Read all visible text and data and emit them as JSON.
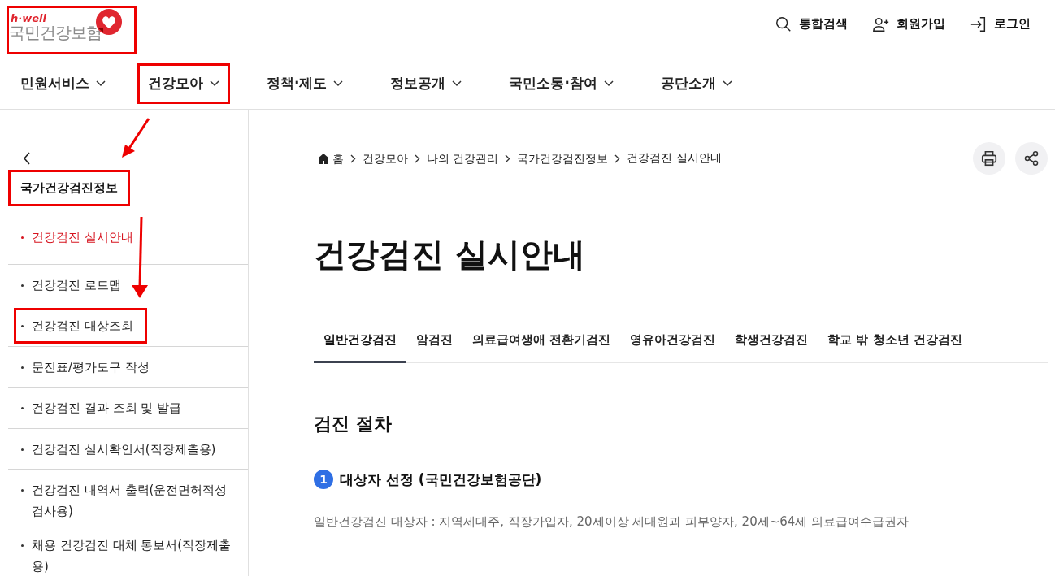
{
  "logo": {
    "tagline": "h·well",
    "name": "국민건강보험",
    "highlighted": true
  },
  "utility_links": [
    {
      "kind": "search",
      "label": "통합검색"
    },
    {
      "kind": "signup",
      "label": "회원가입"
    },
    {
      "kind": "login",
      "label": "로그인"
    }
  ],
  "nav": [
    {
      "label": "민원서비스",
      "highlighted": false
    },
    {
      "label": "건강모아",
      "highlighted": true
    },
    {
      "label": "정책·제도",
      "highlighted": false
    },
    {
      "label": "정보공개",
      "highlighted": false
    },
    {
      "label": "국민소통·참여",
      "highlighted": false
    },
    {
      "label": "공단소개",
      "highlighted": false
    }
  ],
  "sidebar": {
    "title": "국가건강검진정보",
    "title_highlighted": true,
    "items": [
      {
        "label": "건강검진 실시안내",
        "selected": true,
        "highlighted": false
      },
      {
        "label": "건강검진 로드맵",
        "selected": false,
        "highlighted": false
      },
      {
        "label": "건강검진 대상조회",
        "selected": false,
        "highlighted": true
      },
      {
        "label": "문진표/평가도구 작성",
        "selected": false,
        "highlighted": false
      },
      {
        "label": "건강검진 결과 조회 및 발급",
        "selected": false,
        "highlighted": false
      },
      {
        "label": "건강검진 실시확인서(직장제출용)",
        "selected": false,
        "highlighted": false
      },
      {
        "label": "건강검진 내역서 출력(운전면허적성검사용)",
        "selected": false,
        "highlighted": false
      },
      {
        "label": "채용 건강검진 대체 통보서(직장제출용)",
        "selected": false,
        "highlighted": false
      }
    ]
  },
  "breadcrumb": [
    "홈",
    "건강모아",
    "나의 건강관리",
    "국가건강검진정보",
    "건강검진 실시안내"
  ],
  "page_title": "건강검진 실시안내",
  "tabs": [
    {
      "label": "일반건강검진",
      "selected": true
    },
    {
      "label": "암검진",
      "selected": false
    },
    {
      "label": "의료급여생애 전환기검진",
      "selected": false
    },
    {
      "label": "영유아건강검진",
      "selected": false
    },
    {
      "label": "학생건강검진",
      "selected": false
    },
    {
      "label": "학교 밖 청소년 건강검진",
      "selected": false
    }
  ],
  "section_title": "검진 절차",
  "steps": [
    {
      "number": "1",
      "title": "대상자 선정 (국민건강보험공단)",
      "text": "일반건강검진 대상자 : 지역세대주, 직장가입자, 20세이상 세대원과 피부양자, 20세~64세 의료급여수급권자"
    }
  ]
}
